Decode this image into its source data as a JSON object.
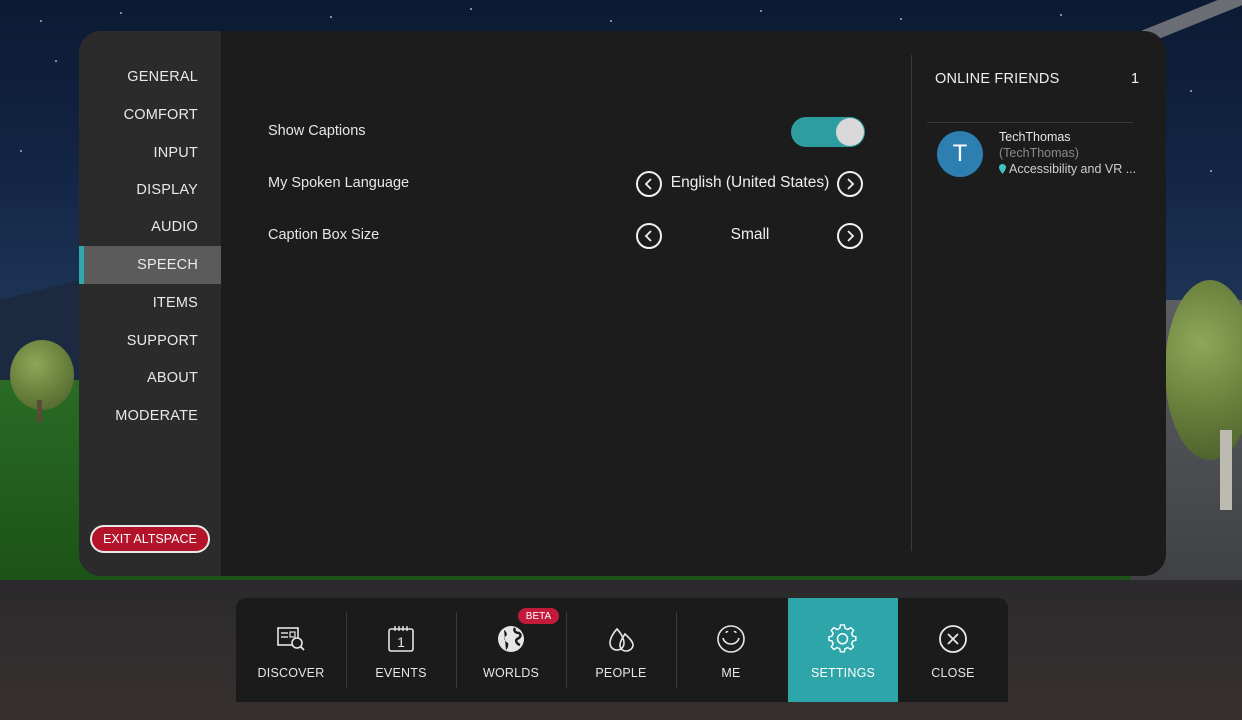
{
  "sidebar": {
    "items": [
      {
        "label": "GENERAL"
      },
      {
        "label": "COMFORT"
      },
      {
        "label": "INPUT"
      },
      {
        "label": "DISPLAY"
      },
      {
        "label": "AUDIO"
      },
      {
        "label": "SPEECH",
        "active": true
      },
      {
        "label": "ITEMS"
      },
      {
        "label": "SUPPORT"
      },
      {
        "label": "ABOUT"
      },
      {
        "label": "MODERATE"
      }
    ],
    "exit_label": "EXIT ALTSPACE"
  },
  "speech": {
    "show_captions": {
      "label": "Show Captions",
      "enabled": true
    },
    "spoken_language": {
      "label": "My Spoken Language",
      "value": "English (United States)"
    },
    "caption_box_size": {
      "label": "Caption Box Size",
      "value": "Small"
    }
  },
  "friends": {
    "title": "ONLINE FRIENDS",
    "count": "1",
    "list": [
      {
        "initial": "T",
        "name": "TechThomas",
        "handle": "(TechThomas)",
        "location": "Accessibility and VR ..."
      }
    ]
  },
  "navbar": {
    "items": [
      {
        "label": "DISCOVER",
        "icon": "discover-icon"
      },
      {
        "label": "EVENTS",
        "icon": "calendar-icon",
        "icon_text": "1"
      },
      {
        "label": "WORLDS",
        "icon": "globe-icon",
        "badge": "BETA"
      },
      {
        "label": "PEOPLE",
        "icon": "people-icon"
      },
      {
        "label": "ME",
        "icon": "smiley-icon"
      },
      {
        "label": "SETTINGS",
        "icon": "gear-icon",
        "active": true
      },
      {
        "label": "CLOSE",
        "icon": "close-icon"
      }
    ]
  },
  "colors": {
    "accent": "#2ea5a9",
    "exit_button": "#b3142a",
    "avatar": "#2c7fb0",
    "beta_badge": "#c3193b"
  }
}
